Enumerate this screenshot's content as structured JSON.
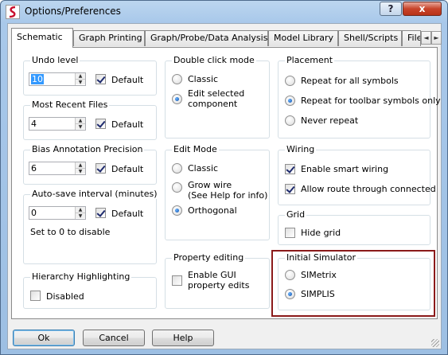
{
  "window": {
    "title": "Options/Preferences",
    "help_button": "?",
    "close_button": "x"
  },
  "tabs": [
    {
      "label": "Schematic"
    },
    {
      "label": "Graph Printing"
    },
    {
      "label": "Graph/Probe/Data Analysis"
    },
    {
      "label": "Model Library"
    },
    {
      "label": "Shell/Scripts"
    },
    {
      "label": "File"
    }
  ],
  "tab_scroll": {
    "left": "◄",
    "right": "►"
  },
  "undo": {
    "title": "Undo level",
    "value": "10",
    "default_label": "Default",
    "default_checked": true
  },
  "recent": {
    "title": "Most Recent Files",
    "value": "4",
    "default_label": "Default",
    "default_checked": true
  },
  "bias": {
    "title": "Bias Annotation Precision",
    "value": "6",
    "default_label": "Default",
    "default_checked": true
  },
  "autosave": {
    "title": "Auto-save interval (minutes)",
    "value": "0",
    "default_label": "Default",
    "default_checked": true,
    "note": "Set to 0 to disable"
  },
  "hierarchy": {
    "title": "Hierarchy Highlighting",
    "option": "Disabled",
    "checked": false
  },
  "double_click": {
    "title": "Double click mode",
    "options": [
      "Classic",
      "Edit selected",
      "component"
    ],
    "selected": "Edit selected component"
  },
  "edit_mode": {
    "title": "Edit Mode",
    "options": [
      "Classic",
      "Grow wire",
      "(See Help for info)",
      "Orthogonal"
    ],
    "selected": "Orthogonal"
  },
  "property_editing": {
    "title": "Property editing",
    "line1": "Enable GUI",
    "line2": "property edits",
    "checked": false
  },
  "placement": {
    "title": "Placement",
    "options": [
      "Repeat for all symbols",
      "Repeat for toolbar symbols only",
      "Never repeat"
    ],
    "selected": "Repeat for toolbar symbols only"
  },
  "wiring": {
    "title": "Wiring",
    "options": [
      "Enable smart wiring",
      "Allow route through connected"
    ],
    "checked": [
      true,
      true
    ]
  },
  "grid": {
    "title": "Grid",
    "option": "Hide grid",
    "checked": false
  },
  "simulator": {
    "title": "Initial Simulator",
    "options": [
      "SIMetrix",
      "SIMPLIS"
    ],
    "selected": "SIMPLIS"
  },
  "buttons": {
    "ok": "Ok",
    "cancel": "Cancel",
    "help": "Help"
  },
  "colors": {
    "highlight_border": "#8b1a1a",
    "selection": "#3399ff"
  }
}
